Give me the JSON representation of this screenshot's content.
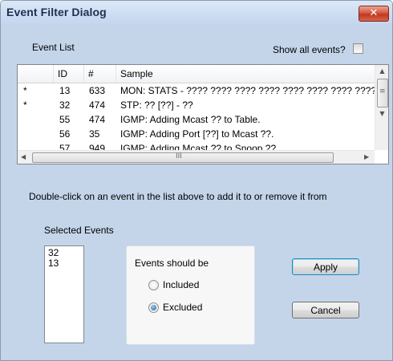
{
  "window": {
    "title": "Event Filter Dialog",
    "close_glyph": "✕"
  },
  "event_list": {
    "label": "Event List",
    "show_all_label": "Show all events?",
    "show_all_checked": false,
    "columns": [
      "",
      "ID",
      "#",
      "Sample"
    ],
    "rows": [
      {
        "mark": "*",
        "id": "13",
        "count": "633",
        "sample": "MON: STATS - ???? ???? ???? ???? ???? ???? ???? ????"
      },
      {
        "mark": "*",
        "id": "32",
        "count": "474",
        "sample": "STP: ?? [??] - ??"
      },
      {
        "mark": "",
        "id": "55",
        "count": "474",
        "sample": "IGMP: Adding Mcast ?? to Table."
      },
      {
        "mark": "",
        "id": "56",
        "count": "35",
        "sample": "IGMP: Adding Port [??] to Mcast ??."
      },
      {
        "mark": "",
        "id": "57",
        "count": "949",
        "sample": "IGMP: Adding Mcast ?? to Snoop ??"
      }
    ],
    "scrollbar_glyphs": {
      "up": "▲",
      "down": "▼",
      "left": "◀",
      "right": "▶",
      "grip_v": "≡",
      "grip_h": "III"
    }
  },
  "hint": "Double-click on an event in the list above to add it to or remove it from",
  "selected": {
    "label": "Selected Events",
    "items": [
      "32",
      "13"
    ]
  },
  "mode": {
    "label": "Events should be",
    "options": [
      {
        "label": "Included",
        "selected": false
      },
      {
        "label": "Excluded",
        "selected": true
      }
    ]
  },
  "buttons": {
    "apply": "Apply",
    "cancel": "Cancel"
  }
}
